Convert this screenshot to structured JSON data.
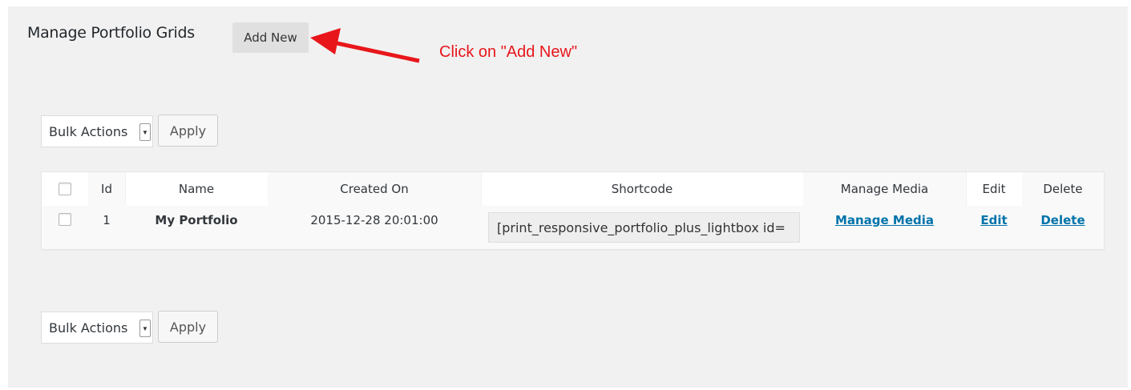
{
  "header": {
    "title": "Manage Portfolio Grids",
    "add_new_label": "Add New"
  },
  "annotation": {
    "text": "Click on \"Add New\"",
    "color": "#e8161b"
  },
  "bulk_top": {
    "select_value": "Bulk Actions",
    "apply_label": "Apply"
  },
  "bulk_bottom": {
    "select_value": "Bulk Actions",
    "apply_label": "Apply"
  },
  "table": {
    "columns": [
      "Id",
      "Name",
      "Created On",
      "Shortcode",
      "Manage Media",
      "Edit",
      "Delete"
    ],
    "rows": [
      {
        "id": "1",
        "name": "My Portfolio",
        "created_on": "2015-12-28 20:01:00",
        "shortcode": "[print_responsive_portfolio_plus_lightbox id=",
        "manage_media": "Manage Media",
        "edit": "Edit",
        "delete": "Delete"
      }
    ]
  },
  "colors": {
    "link": "#0073aa",
    "background": "#f1f1f1"
  },
  "icons": {
    "dropdown": "caret-down-icon",
    "annotation_arrow": "red-arrow-icon"
  }
}
